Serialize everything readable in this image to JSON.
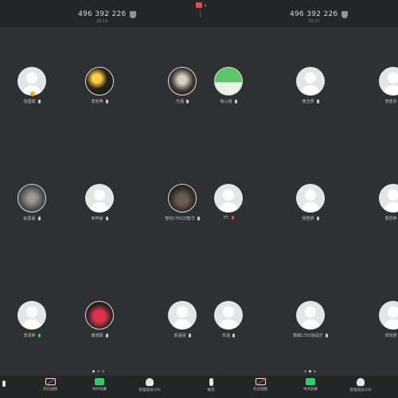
{
  "left_panel": {
    "meeting_id": "496 392 226",
    "time": "29:19"
  },
  "right_panel": {
    "meeting_id": "496 392 226",
    "time": "29:20"
  },
  "participants": [
    {
      "name": "张国斌",
      "mic": "gray"
    },
    {
      "name": "李欣萍",
      "mic": "gray"
    },
    {
      "name": "万涵",
      "mic": "gray"
    },
    {
      "name": "徐心悦",
      "mic": "gray"
    },
    {
      "name": "黄玉妍",
      "mic": "gray"
    },
    {
      "name": "李佳欣",
      "mic": "gray"
    },
    {
      "name": "赵思豪",
      "mic": "gray"
    },
    {
      "name": "朱梓豪",
      "mic": "gray"
    },
    {
      "name": "智控1701刘智华",
      "mic": "gray"
    },
    {
      "name": "YT.",
      "mic": "red"
    },
    {
      "name": "杨雪妍",
      "mic": "gray"
    },
    {
      "name": "周舒婷",
      "mic": "gray"
    },
    {
      "name": "李泽婷",
      "mic": "green"
    },
    {
      "name": "秦茂阳",
      "mic": "gray"
    },
    {
      "name": "郭涵清",
      "mic": "gray"
    },
    {
      "name": "苏涵",
      "mic": "gray"
    },
    {
      "name": "数媒1701徐润方",
      "mic": "gray"
    },
    {
      "name": "邓欣妍",
      "mic": "gray"
    }
  ],
  "toolbar": {
    "left": {
      "video": "开启视频",
      "share": "共享屏幕",
      "members": "管理成员(19)"
    },
    "right": {
      "mute": "静音",
      "video": "开启视频",
      "share": "共享屏幕",
      "members": "管理成员(19)"
    }
  },
  "colors": {
    "recording": "#e74c3c",
    "share": "#2ecc71",
    "muted": "#e74c3c",
    "speaking": "#2ecc71"
  }
}
